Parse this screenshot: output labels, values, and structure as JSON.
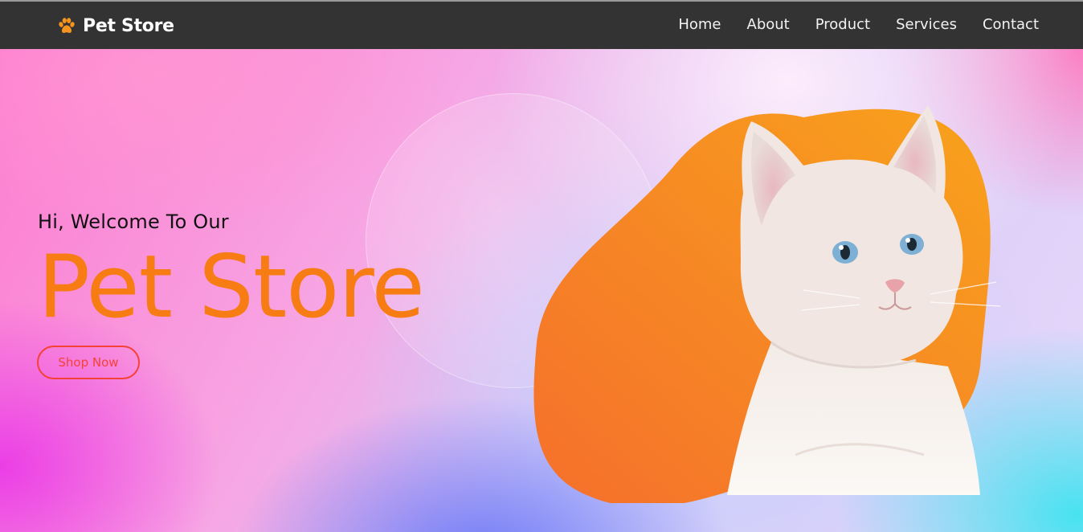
{
  "header": {
    "brand_icon": "paw-icon",
    "brand_name": "Pet Store",
    "nav_items": [
      "Home",
      "About",
      "Product",
      "Services",
      "Contact"
    ]
  },
  "hero": {
    "greeting": "Hi, Welcome To Our",
    "title": "Pet Store",
    "cta_label": "Shop Now",
    "image": "kitten-photo"
  },
  "colors": {
    "navbar": "#333333",
    "accent_orange": "#f77c14",
    "cta_red": "#f44336"
  }
}
